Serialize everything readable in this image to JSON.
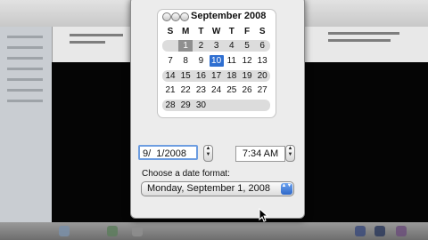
{
  "calendar": {
    "month_title": "September 2008",
    "weekdays": [
      "S",
      "M",
      "T",
      "W",
      "T",
      "F",
      "S"
    ],
    "weeks": [
      [
        "",
        "1",
        "2",
        "3",
        "4",
        "5",
        "6"
      ],
      [
        "7",
        "8",
        "9",
        "10",
        "11",
        "12",
        "13"
      ],
      [
        "14",
        "15",
        "16",
        "17",
        "18",
        "19",
        "20"
      ],
      [
        "21",
        "22",
        "23",
        "24",
        "25",
        "26",
        "27"
      ],
      [
        "28",
        "29",
        "30",
        "",
        "",
        "",
        ""
      ]
    ],
    "selected_day": "10",
    "first_day": "1"
  },
  "date_field": {
    "value": "9/  1/2008"
  },
  "time_field": {
    "value": "7:34 AM"
  },
  "stepper": {
    "up": "▲",
    "down": "▼"
  },
  "format": {
    "label": "Choose a date format:",
    "selected": "Monday, September 1, 2008",
    "arrows": "▲▼"
  },
  "colors": {
    "selection": "#2f6fd1",
    "focus_ring": "#6d9de0"
  },
  "icons": [
    "nav-back-icon",
    "nav-today-icon",
    "nav-forward-icon",
    "stepper-arrows-icon",
    "popup-arrows-icon",
    "mouse-pointer-icon"
  ]
}
